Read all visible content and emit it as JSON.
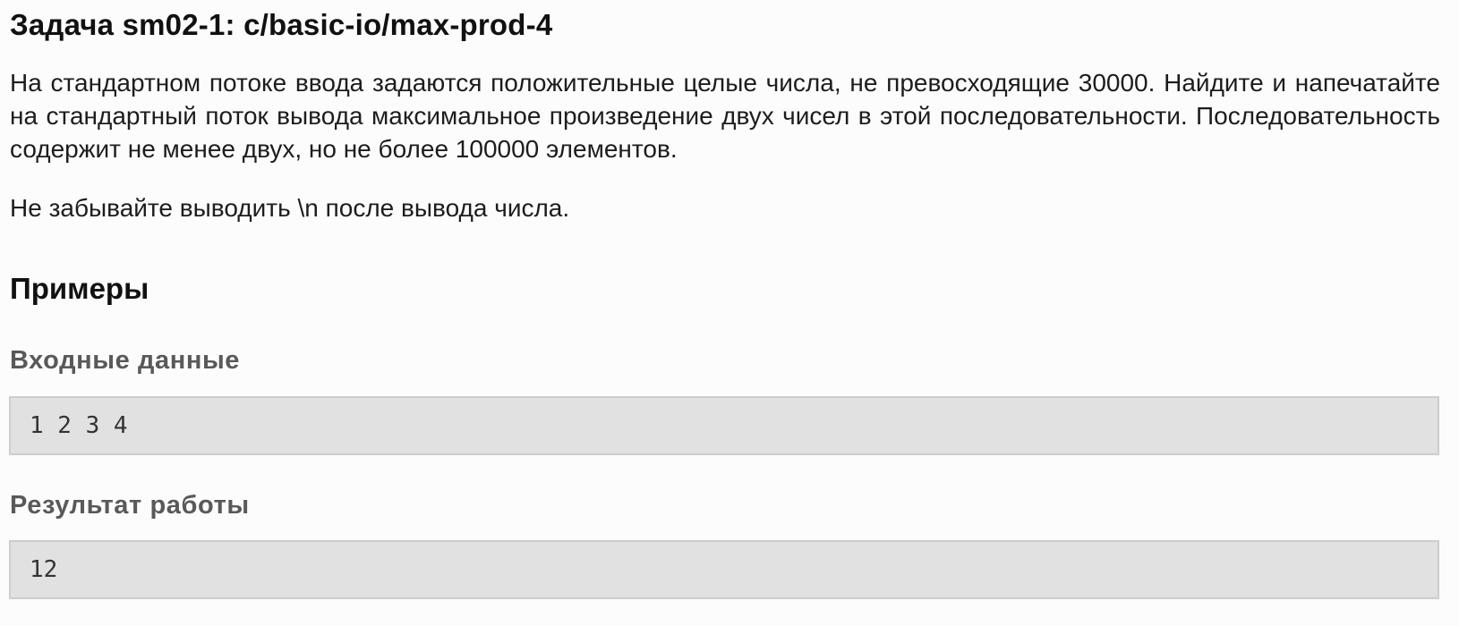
{
  "problem": {
    "title": "Задача sm02-1: c/basic-io/max-prod-4",
    "description": "На стандартном потоке ввода задаются положительные целые числа, не превосходящие 30000. Найдите и напечатайте на стандартный поток вывода максимальное произведение двух чисел в этой последовательности. Последовательность содержит не менее двух, но не более 100000 элементов.",
    "note": "Не забывайте выводить \\n после вывода числа."
  },
  "examples": {
    "heading": "Примеры",
    "input_label": "Входные данные",
    "input_value": "1 2 3 4",
    "output_label": "Результат работы",
    "output_value": "12"
  }
}
